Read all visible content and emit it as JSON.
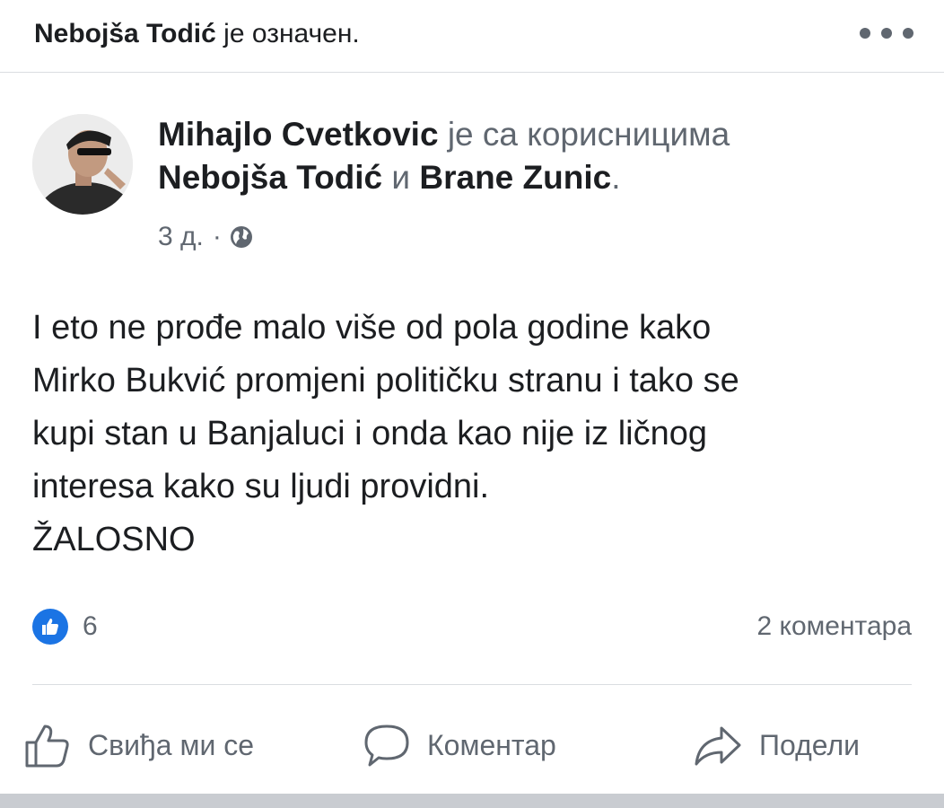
{
  "tag_bar": {
    "name": "Nebojša Todić",
    "suffix": "је означен."
  },
  "post": {
    "author": "Mihajlo Cvetkovic",
    "with_text": "је са корисницима",
    "tagged_1": "Nebojša Todić",
    "and_text": "и",
    "tagged_2": "Brane Zunic",
    "period": ".",
    "time": "3 д.",
    "dot": "·",
    "privacy_icon": "globe-icon",
    "body": "I eto ne prođe malo više od pola godine kako\nMirko Bukvić promjeni političku stranu i tako se\nkupi stan u Banjaluci i onda kao nije iz ličnog\ninteresa kako su ljudi providni.\nŽALOSNO"
  },
  "stats": {
    "like_count": "6",
    "comments": "2 коментара"
  },
  "actions": {
    "like": "Свиђа ми се",
    "comment": "Коментар",
    "share": "Подели"
  },
  "colors": {
    "like_blue": "#1b74e4",
    "secondary_text": "#606770",
    "divider": "#dadde1"
  }
}
